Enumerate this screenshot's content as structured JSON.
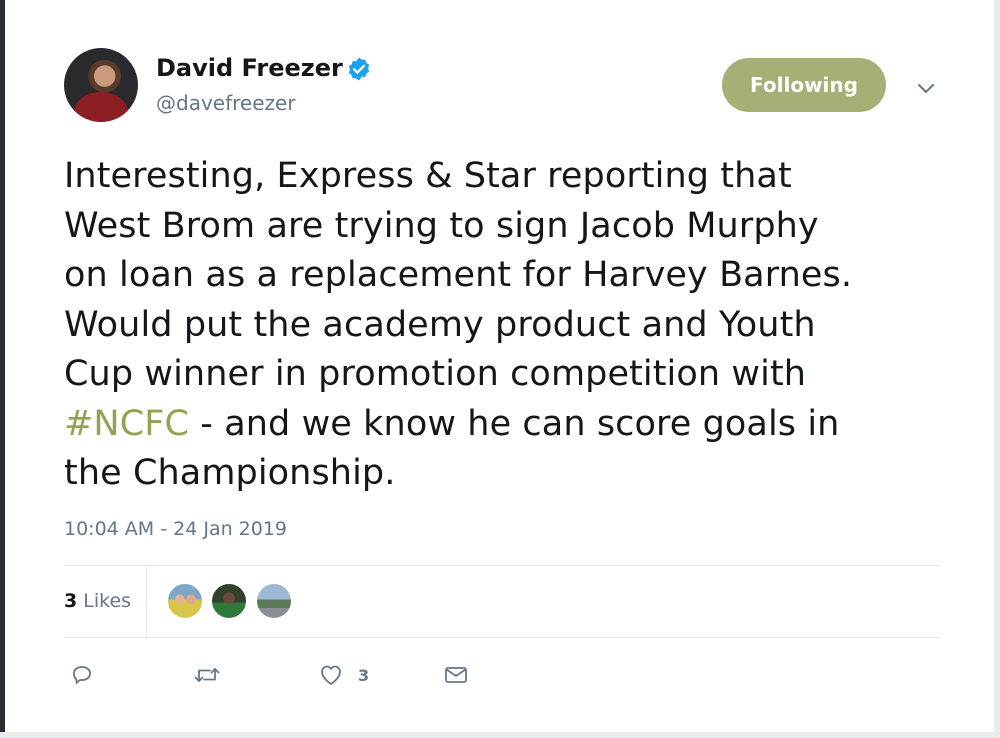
{
  "tweet": {
    "author": {
      "display_name": "David Freezer",
      "handle": "@davefreezer",
      "verified": true
    },
    "follow_button_label": "Following",
    "text_lines": [
      "Interesting, Express & Star reporting that",
      "West Brom are trying to sign Jacob Murphy",
      "on loan as a replacement for Harvey Barnes.",
      "Would put the academy product and Youth",
      "Cup winner in promotion competition with"
    ],
    "line6": {
      "hashtag": "#NCFC",
      "rest": " - and we know he can score goals in"
    },
    "text_last_line": "the Championship.",
    "timestamp": "10:04 AM - 24 Jan 2019",
    "likes": {
      "count": "3",
      "label": "Likes"
    },
    "actions": {
      "like_count": "3"
    }
  },
  "icons": {
    "verified": "verified-badge-icon",
    "caret": "chevron-down-icon",
    "reply": "reply-icon",
    "retweet": "retweet-icon",
    "like": "heart-icon",
    "dm": "envelope-icon"
  },
  "colors": {
    "follow_button_bg": "#a4b075",
    "hashtag": "#94a24f",
    "verified_blue": "#1da1f2",
    "secondary_text": "#657786",
    "divider": "#e1e8ed"
  }
}
